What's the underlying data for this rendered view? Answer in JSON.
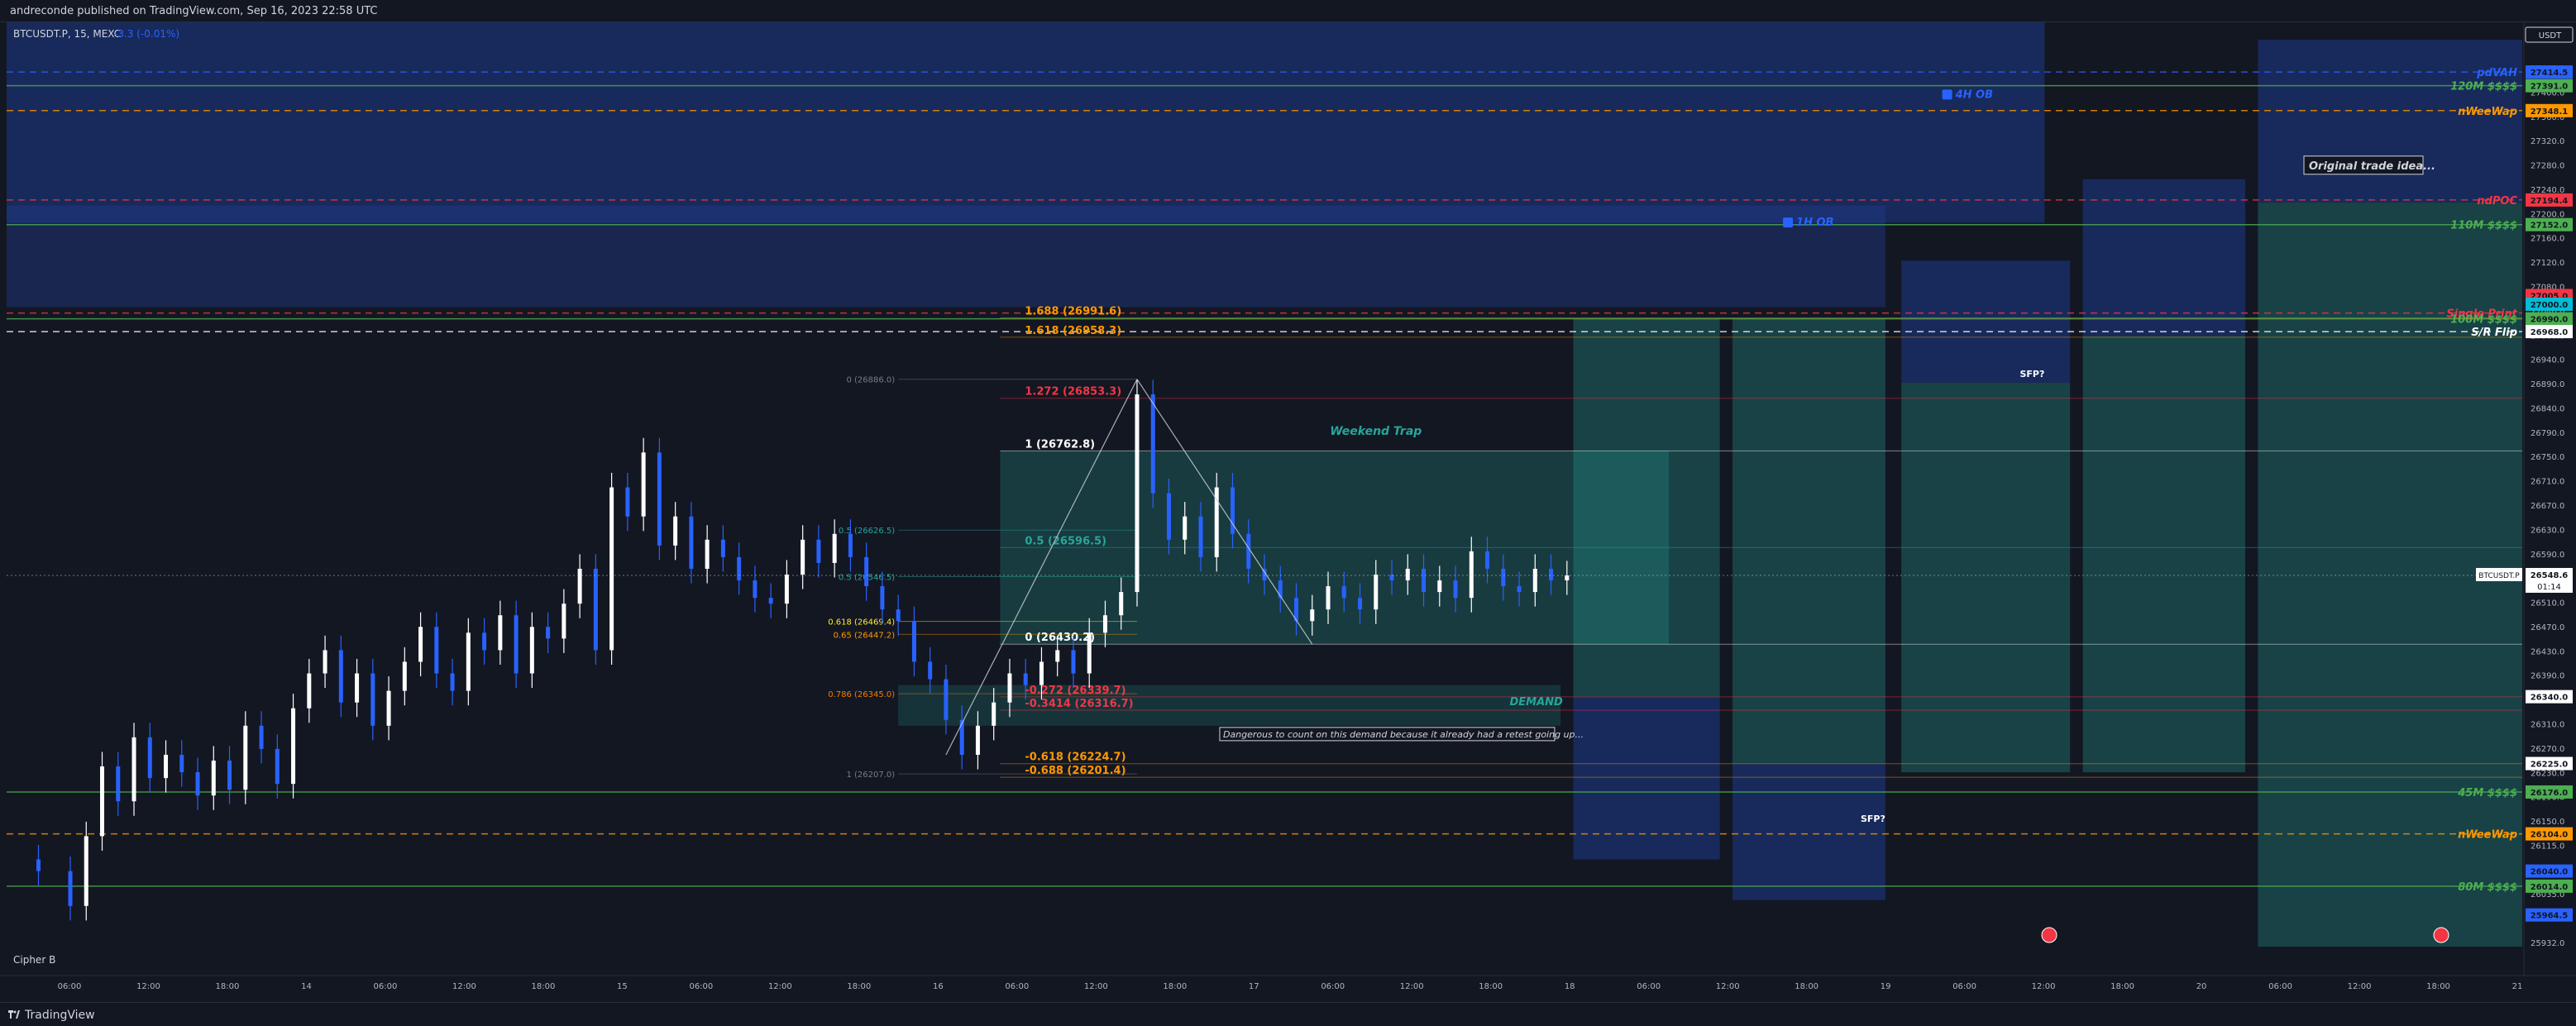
{
  "header": {
    "publisher_line": "andreconde published on TradingView.com, Sep 16, 2023 22:58 UTC"
  },
  "legend": {
    "symbol_line": "BTCUSDT.P, 15, MEXC",
    "change": "-3.3 (-0.01%)"
  },
  "currency": "USDT",
  "indicator_label": "Cipher B",
  "footer": {
    "brand": "TradingView"
  },
  "colors": {
    "background": "#131722",
    "up_candle": "#ffffff",
    "down_candle": "#2962ff",
    "ob_zone": "#1e3a8a",
    "teal_zone": "#26a69a",
    "orange": "#ff9800",
    "red": "#f23645",
    "green": "#4caf50"
  },
  "chart_data": {
    "type": "candlestick",
    "symbol": "BTCUSDT.P",
    "interval": "15",
    "exchange": "MEXC",
    "y_range": [
      25910,
      27500
    ],
    "x_ticks": [
      "06:00",
      "12:00",
      "18:00",
      "14",
      "06:00",
      "12:00",
      "18:00",
      "15",
      "06:00",
      "12:00",
      "18:00",
      "16",
      "06:00",
      "12:00",
      "18:00",
      "17",
      "06:00",
      "12:00",
      "18:00",
      "18",
      "06:00",
      "12:00",
      "18:00",
      "19",
      "06:00",
      "12:00",
      "18:00",
      "20",
      "06:00",
      "12:00",
      "18:00",
      "21"
    ],
    "y_ticks": [
      "27440.0",
      "27400.0",
      "27360.0",
      "27320.0",
      "27280.0",
      "27240.0",
      "27200.0",
      "27160.0",
      "27120.0",
      "27080.0",
      "27040.0",
      "27000.0",
      "26940.0",
      "26890.0",
      "26840.0",
      "26790.0",
      "26750.0",
      "26710.0",
      "26670.0",
      "26630.0",
      "26590.0",
      "26550.0",
      "26510.0",
      "26470.0",
      "26430.0",
      "26390.0",
      "26350.0",
      "26310.0",
      "26270.0",
      "26230.0",
      "26190.0",
      "26150.0",
      "26115.0",
      "26075.0",
      "26035.0",
      "25995.0",
      "25932.0"
    ],
    "last_price": {
      "label": "BTCUSDT.P",
      "value": "26548.6",
      "countdown": "01:14",
      "price": 26548.6
    },
    "candle_path": [
      [
        0,
        26060
      ],
      [
        10,
        26040
      ],
      [
        20,
        25980
      ],
      [
        25,
        26100
      ],
      [
        30,
        26220
      ],
      [
        35,
        26160
      ],
      [
        40,
        26270
      ],
      [
        45,
        26200
      ],
      [
        50,
        26240
      ],
      [
        55,
        26210
      ],
      [
        60,
        26170
      ],
      [
        65,
        26230
      ],
      [
        70,
        26180
      ],
      [
        75,
        26290
      ],
      [
        80,
        26250
      ],
      [
        85,
        26190
      ],
      [
        90,
        26320
      ],
      [
        95,
        26380
      ],
      [
        100,
        26420
      ],
      [
        105,
        26330
      ],
      [
        110,
        26380
      ],
      [
        115,
        26290
      ],
      [
        120,
        26350
      ],
      [
        125,
        26400
      ],
      [
        130,
        26460
      ],
      [
        135,
        26380
      ],
      [
        140,
        26350
      ],
      [
        145,
        26450
      ],
      [
        150,
        26420
      ],
      [
        155,
        26480
      ],
      [
        160,
        26380
      ],
      [
        165,
        26460
      ],
      [
        170,
        26440
      ],
      [
        175,
        26500
      ],
      [
        180,
        26560
      ],
      [
        185,
        26420
      ],
      [
        190,
        26700
      ],
      [
        195,
        26650
      ],
      [
        200,
        26760
      ],
      [
        205,
        26600
      ],
      [
        210,
        26650
      ],
      [
        215,
        26560
      ],
      [
        220,
        26610
      ],
      [
        225,
        26580
      ],
      [
        230,
        26540
      ],
      [
        235,
        26510
      ],
      [
        240,
        26500
      ],
      [
        245,
        26550
      ],
      [
        250,
        26610
      ],
      [
        255,
        26570
      ],
      [
        260,
        26620
      ],
      [
        265,
        26580
      ],
      [
        270,
        26530
      ],
      [
        275,
        26490
      ],
      [
        280,
        26470
      ],
      [
        285,
        26400
      ],
      [
        290,
        26370
      ],
      [
        295,
        26300
      ],
      [
        300,
        26240
      ],
      [
        305,
        26290
      ],
      [
        310,
        26330
      ],
      [
        315,
        26380
      ],
      [
        320,
        26360
      ],
      [
        325,
        26400
      ],
      [
        330,
        26420
      ],
      [
        335,
        26380
      ],
      [
        340,
        26450
      ],
      [
        345,
        26480
      ],
      [
        350,
        26520
      ],
      [
        355,
        26860
      ],
      [
        360,
        26690
      ],
      [
        365,
        26610
      ],
      [
        370,
        26650
      ],
      [
        375,
        26580
      ],
      [
        380,
        26700
      ],
      [
        385,
        26620
      ],
      [
        390,
        26560
      ],
      [
        395,
        26540
      ],
      [
        400,
        26510
      ],
      [
        405,
        26470
      ],
      [
        410,
        26490
      ],
      [
        415,
        26530
      ],
      [
        420,
        26510
      ],
      [
        425,
        26490
      ],
      [
        430,
        26550
      ],
      [
        435,
        26540
      ],
      [
        440,
        26560
      ],
      [
        445,
        26520
      ],
      [
        450,
        26540
      ],
      [
        455,
        26510
      ],
      [
        460,
        26590
      ],
      [
        465,
        26560
      ],
      [
        470,
        26530
      ],
      [
        475,
        26520
      ],
      [
        480,
        26560
      ],
      [
        485,
        26540
      ],
      [
        490,
        26548.6
      ]
    ],
    "zones": [
      {
        "name": "4H OB",
        "label": "4H OB",
        "t0": 0,
        "t1": 640,
        "p_top": 27500,
        "p_bottom": 27155,
        "fill": "#1e3a8a",
        "opacity": 0.55
      },
      {
        "name": "1H OB",
        "label": "1H OB",
        "t0": 0,
        "t1": 590,
        "p_top": 27185,
        "p_bottom": 27010,
        "fill": "#1e3a8a",
        "opacity": 0.45
      },
      {
        "name": "weekend-trap",
        "label": "Weekend Trap",
        "t0": 312,
        "t1": 522,
        "p_top": 26762.8,
        "p_bottom": 26430.2,
        "fill": "#26a69a",
        "opacity": 0.25
      },
      {
        "name": "demand",
        "label": "DEMAND",
        "t0": 280,
        "t1": 488,
        "p_top": 26360,
        "p_bottom": 26290,
        "fill": "#26a69a",
        "opacity": 0.2
      },
      {
        "name": "proj-1-teal",
        "label": "",
        "t0": 492,
        "t1": 538,
        "p_top": 26990,
        "p_bottom": 26340,
        "fill": "#26a69a",
        "opacity": 0.3
      },
      {
        "name": "proj-1-blue",
        "label": "",
        "t0": 492,
        "t1": 538,
        "p_top": 26340,
        "p_bottom": 26060,
        "fill": "#1e3a8a",
        "opacity": 0.55
      },
      {
        "name": "proj-2-teal",
        "label": "",
        "t0": 542,
        "t1": 590,
        "p_top": 26990,
        "p_bottom": 26225,
        "fill": "#26a69a",
        "opacity": 0.3
      },
      {
        "name": "proj-2-blue",
        "label": "",
        "t0": 542,
        "t1": 590,
        "p_top": 26225,
        "p_bottom": 25990,
        "fill": "#1e3a8a",
        "opacity": 0.55
      },
      {
        "name": "proj-3-blue",
        "label": "",
        "t0": 595,
        "t1": 648,
        "p_top": 27090,
        "p_bottom": 26880,
        "fill": "#1e3a8a",
        "opacity": 0.55
      },
      {
        "name": "proj-3-teal",
        "label": "",
        "t0": 595,
        "t1": 648,
        "p_top": 26880,
        "p_bottom": 26210,
        "fill": "#26a69a",
        "opacity": 0.3
      },
      {
        "name": "proj-4-blue",
        "label": "",
        "t0": 652,
        "t1": 703,
        "p_top": 27230,
        "p_bottom": 26960,
        "fill": "#1e3a8a",
        "opacity": 0.55
      },
      {
        "name": "proj-4-teal",
        "label": "",
        "t0": 652,
        "t1": 703,
        "p_top": 26960,
        "p_bottom": 26210,
        "fill": "#26a69a",
        "opacity": 0.3
      },
      {
        "name": "proj-5-blue",
        "label": "",
        "t0": 707,
        "t1": 790,
        "p_top": 27470,
        "p_bottom": 27190,
        "fill": "#1e3a8a",
        "opacity": 0.55
      },
      {
        "name": "proj-5-teal",
        "label": "",
        "t0": 707,
        "t1": 790,
        "p_top": 27190,
        "p_bottom": 25910,
        "fill": "#26a69a",
        "opacity": 0.3
      }
    ],
    "levels": [
      {
        "name": "pdVAH",
        "label": "pdVAH",
        "price": 27414.5,
        "value": "27414.5",
        "color": "#2962ff",
        "dash": "8,6"
      },
      {
        "name": "120M $$$$",
        "label": "120M $$$$",
        "price": 27391.0,
        "value": "27391.0",
        "color": "#4caf50",
        "dash": ""
      },
      {
        "name": "nWeeWap",
        "label": "nWeeWap",
        "price": 27348.1,
        "value": "27348.1",
        "color": "#ff9800",
        "dash": "8,6"
      },
      {
        "name": "ndPOC",
        "label": "ndPOC",
        "price": 27194.4,
        "value": "27194.4",
        "color": "#f23645",
        "dash": "8,6"
      },
      {
        "name": "110M $$$$",
        "label": "110M $$$$",
        "price": 27152.0,
        "value": "27152.0",
        "color": "#4caf50",
        "dash": ""
      },
      {
        "name": "Single Print",
        "label": "Single Print",
        "price": 27000.0,
        "value": "27009.0",
        "color": "#f23645",
        "dash": "8,6"
      },
      {
        "name": "100M $$$$",
        "label": "100M $$$$",
        "price": 26990.0,
        "value": "26990.0",
        "color": "#4caf50",
        "dash": ""
      },
      {
        "name": "S/R Flip",
        "label": "S/R Flip",
        "price": 26968.0,
        "value": "26968.0",
        "color": "#ffffff",
        "dash": "8,6"
      },
      {
        "name": "45M $$$$",
        "label": "45M $$$$",
        "price": 26176.0,
        "value": "26176.0",
        "color": "#4caf50",
        "dash": ""
      },
      {
        "name": "nWeeWap-2",
        "label": "nWeeWap",
        "price": 26104.0,
        "value": "26104.0",
        "color": "#ff9800",
        "dash": "8,6"
      },
      {
        "name": "80M $$$$",
        "label": "80M $$$$",
        "price": 26014.0,
        "value": "26014.0",
        "color": "#4caf50",
        "dash": ""
      }
    ],
    "extra_price_tags": [
      {
        "value": "27005.0",
        "price": 27030,
        "bg": "#f23645"
      },
      {
        "value": "27000.0",
        "price": 27015,
        "bg": "#00bcd4"
      },
      {
        "value": "26340.0",
        "price": 26340,
        "bg": "#ffffff"
      },
      {
        "value": "26225.0",
        "price": 26225,
        "bg": "#ffffff"
      },
      {
        "value": "26040.0",
        "price": 26040,
        "bg": "#2962ff"
      },
      {
        "value": "25964.5",
        "price": 25964.5,
        "bg": "#2962ff"
      }
    ],
    "fib_main": [
      {
        "label": "1.688 (26991.6)",
        "price": 26991.6,
        "color": "#ff9800"
      },
      {
        "label": "1.618 (26958.3)",
        "price": 26958.3,
        "color": "#ff9800"
      },
      {
        "label": "1.272 (26853.3)",
        "price": 26853.3,
        "color": "#f23645"
      },
      {
        "label": "1 (26762.8)",
        "price": 26762.8,
        "color": "#ffffff"
      },
      {
        "label": "0.5 (26596.5)",
        "price": 26596.5,
        "color": "#26a69a"
      },
      {
        "label": "0 (26430.2)",
        "price": 26430.2,
        "color": "#ffffff"
      },
      {
        "label": "-0.272 (26339.7)",
        "price": 26339.7,
        "color": "#f23645"
      },
      {
        "label": "-0.3414 (26316.7)",
        "price": 26316.7,
        "color": "#f23645"
      },
      {
        "label": "-0.618 (26224.7)",
        "price": 26224.7,
        "color": "#ff9800"
      },
      {
        "label": "-0.688 (26201.4)",
        "price": 26201.4,
        "color": "#ff9800"
      }
    ],
    "fib_prior": [
      {
        "label": "0 (26886.0)",
        "price": 26886.0,
        "color": "#787b86"
      },
      {
        "label": "0.5 (26626.5)",
        "price": 26626.5,
        "color": "#26a69a"
      },
      {
        "label": "0.5 (26546.5)",
        "price": 26546.5,
        "color": "#26a69a"
      },
      {
        "label": "0.618 (26469.4)",
        "price": 26469.4,
        "color": "#ffeb3b"
      },
      {
        "label": "0.65 (26447.2)",
        "price": 26447.2,
        "color": "#ff9800"
      },
      {
        "label": "0.786 (26345.0)",
        "price": 26345.0,
        "color": "#f57c00"
      },
      {
        "label": "1 (26207.0)",
        "price": 26207.0,
        "color": "#787b86"
      }
    ],
    "annotations": {
      "weekend_trap": "Weekend Trap",
      "demand": "DEMAND",
      "ob_4h": "4H OB",
      "ob_1h": "1H OB",
      "sfp_top": "SFP?",
      "sfp_bottom": "SFP?",
      "original_idea": "Original trade idea...",
      "demand_note": "Dangerous to count on this demand because it already had a retest going up..."
    }
  }
}
